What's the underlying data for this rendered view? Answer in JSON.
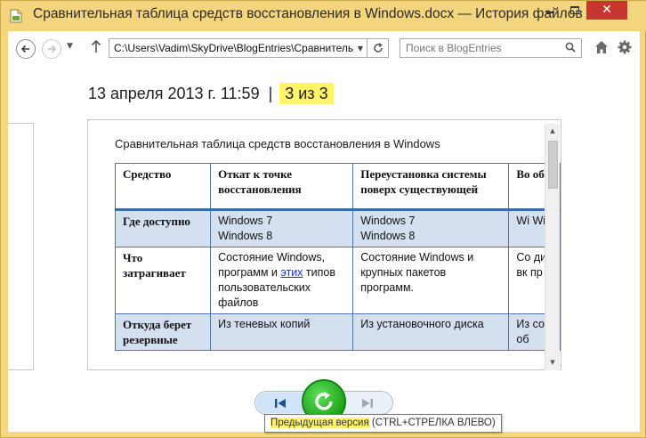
{
  "window": {
    "title": "Сравнительная таблица средств восстановления в Windows.docx — История файлов",
    "min_glyph": "–",
    "close_glyph": "✕"
  },
  "toolbar": {
    "address": "C:\\Users\\Vadim\\SkyDrive\\BlogEntries\\Сравнительная таблица средств восстановления в Windows.docx",
    "search_placeholder": "Поиск в BlogEntries"
  },
  "version": {
    "timestamp": "13 апреля 2013 г. 11:59",
    "separator": "|",
    "count": "3 из 3"
  },
  "document": {
    "heading": "Сравнительная таблица средств восстановления в Windows",
    "columns": [
      "Средство",
      "Откат к точке восстановления",
      "Переустановка системы поверх существующей",
      "Во об"
    ],
    "rows": [
      {
        "label": "Где доступно",
        "cells": [
          "Windows 7\nWindows 8",
          "Windows 7\nWindows 8",
          "Wi Wi"
        ]
      },
      {
        "label": "Что затрагивает",
        "cell1_before": "Состояние Windows, программ и ",
        "cell1_link": "этих",
        "cell1_after": " типов пользовательских файлов",
        "cell2": "Состояние Windows и крупных пакетов программ.",
        "cell3": "Со ди вк пр"
      },
      {
        "label": "Откуда берет резервные",
        "cells": [
          "Из теневых копий",
          "Из установочного диска",
          "Из со об"
        ]
      }
    ]
  },
  "tooltip": {
    "label": "Предыдущая версия",
    "shortcut": "(CTRL+СТРЕЛКА ВЛЕВО)"
  },
  "colors": {
    "frame": "#f2d57d",
    "highlight": "#fff46a",
    "table_border": "#4f75b6",
    "table_shade": "#d4dff0",
    "restore_green": "#1ea41a",
    "close_red": "#c7372f"
  },
  "icons": [
    "document-icon",
    "back-arrow-icon",
    "forward-arrow-icon",
    "up-arrow-icon",
    "refresh-icon",
    "search-icon",
    "home-icon",
    "gear-icon",
    "previous-version-icon",
    "restore-icon",
    "next-version-icon"
  ]
}
